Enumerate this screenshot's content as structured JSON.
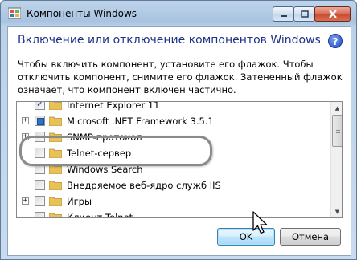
{
  "window": {
    "title": "Компоненты Windows"
  },
  "header": {
    "title": "Включение или отключение компонентов Windows",
    "help_icon": "?"
  },
  "description": "Чтобы включить компонент, установите его флажок. Чтобы отключить компонент, снимите его флажок. Затененный флажок означает, что компонент включен частично.",
  "features": [
    {
      "label": "Internet Explorer 11",
      "state": "checked",
      "expandable": false
    },
    {
      "label": "Microsoft .NET Framework 3.5.1",
      "state": "partial",
      "expandable": true
    },
    {
      "label": "SNMP-протокол",
      "state": "unchecked",
      "expandable": true
    },
    {
      "label": "Telnet-сервер",
      "state": "unchecked",
      "expandable": false
    },
    {
      "label": "Windows Search",
      "state": "unchecked",
      "expandable": false
    },
    {
      "label": "Внедряемое веб-ядро служб IIS",
      "state": "unchecked",
      "expandable": false
    },
    {
      "label": "Игры",
      "state": "unchecked",
      "expandable": true
    },
    {
      "label": "Клиент Telnet",
      "state": "unchecked",
      "expandable": false
    }
  ],
  "expander_symbol": "+",
  "checkmark_symbol": "✓",
  "buttons": {
    "ok": "OK",
    "cancel": "Отмена"
  },
  "colors": {
    "heading": "#1e3287",
    "accent": "#2f73c9",
    "folder": "#e8c15a"
  }
}
